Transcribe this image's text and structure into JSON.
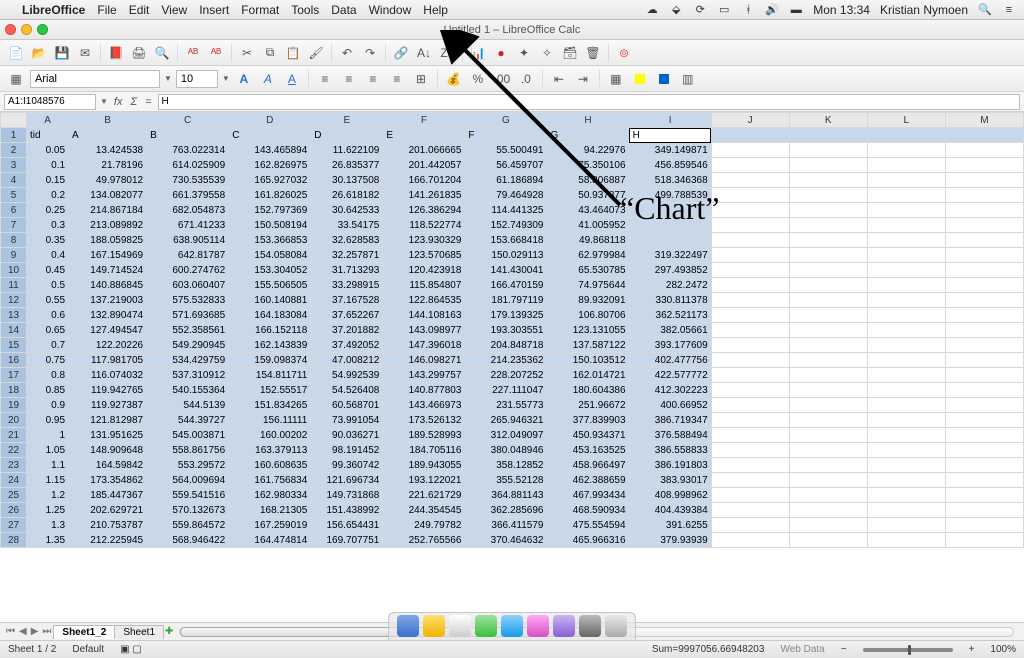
{
  "menubar": {
    "app": "LibreOffice",
    "items": [
      "File",
      "Edit",
      "View",
      "Insert",
      "Format",
      "Tools",
      "Data",
      "Window",
      "Help"
    ],
    "status": {
      "clock": "Mon 13:34",
      "user": "Kristian Nymoen"
    },
    "status_icons": [
      "cloud-icon",
      "dropbox-icon",
      "sync-icon",
      "bluetooth-icon",
      "wifi-icon",
      "volume-icon",
      "battery-icon",
      "input-icon",
      "spotlight-icon",
      "menu-icon"
    ]
  },
  "window": {
    "title": "Untitled 1 – LibreOffice Calc"
  },
  "formatbar": {
    "font": "Arial",
    "size": "10"
  },
  "refbar": {
    "cell": "A1:I1048576",
    "formula": "H"
  },
  "columns": [
    "A",
    "B",
    "C",
    "D",
    "E",
    "F",
    "G",
    "H",
    "I",
    "J",
    "K",
    "L",
    "M"
  ],
  "header_row": [
    "tid",
    "A",
    "B",
    "C",
    "D",
    "E",
    "F",
    "G",
    "H"
  ],
  "rows": [
    [
      "0.05",
      "13.424538",
      "763.022314",
      "143.465894",
      "11.622109",
      "201.066665",
      "55.500491",
      "94.22976",
      "349.149871"
    ],
    [
      "0.1",
      "21.78196",
      "614.025909",
      "162.826975",
      "26.835377",
      "201.442057",
      "56.459707",
      "75.350106",
      "456.859546"
    ],
    [
      "0.15",
      "49.978012",
      "730.535539",
      "165.927032",
      "30.137508",
      "166.701204",
      "61.186894",
      "58.806887",
      "518.346368"
    ],
    [
      "0.2",
      "134.082077",
      "661.379558",
      "161.826025",
      "26.618182",
      "141.261835",
      "79.464928",
      "50.937877",
      "499.788539"
    ],
    [
      "0.25",
      "214.867184",
      "682.054873",
      "152.797369",
      "30.642533",
      "126.386294",
      "114.441325",
      "43.464073",
      ""
    ],
    [
      "0.3",
      "213.089892",
      "671.41233",
      "150.508194",
      "33.54175",
      "118.522774",
      "152.749309",
      "41.005952",
      ""
    ],
    [
      "0.35",
      "188.059825",
      "638.905114",
      "153.366853",
      "32.628583",
      "123.930329",
      "153.668418",
      "49.868118",
      ""
    ],
    [
      "0.4",
      "167.154969",
      "642.81787",
      "154.058084",
      "32.257871",
      "123.570685",
      "150.029113",
      "62.979984",
      "319.322497"
    ],
    [
      "0.45",
      "149.714524",
      "600.274762",
      "153.304052",
      "31.713293",
      "120.423918",
      "141.430041",
      "65.530785",
      "297.493852"
    ],
    [
      "0.5",
      "140.886845",
      "603.060407",
      "155.506505",
      "33.298915",
      "115.854807",
      "166.470159",
      "74.975644",
      "282.2472"
    ],
    [
      "0.55",
      "137.219003",
      "575.532833",
      "160.140881",
      "37.167528",
      "122.864535",
      "181.797119",
      "89.932091",
      "330.811378"
    ],
    [
      "0.6",
      "132.890474",
      "571.693685",
      "164.183084",
      "37.652267",
      "144.108163",
      "179.139325",
      "106.80706",
      "362.521173"
    ],
    [
      "0.65",
      "127.494547",
      "552.358561",
      "166.152118",
      "37.201882",
      "143.098977",
      "193.303551",
      "123.131055",
      "382.05661"
    ],
    [
      "0.7",
      "122.20226",
      "549.290945",
      "162.143839",
      "37.492052",
      "147.396018",
      "204.848718",
      "137.587122",
      "393.177609"
    ],
    [
      "0.75",
      "117.981705",
      "534.429759",
      "159.098374",
      "47.008212",
      "146.098271",
      "214.235362",
      "150.103512",
      "402.477756"
    ],
    [
      "0.8",
      "116.074032",
      "537.310912",
      "154.811711",
      "54.992539",
      "143.299757",
      "228.207252",
      "162.014721",
      "422.577772"
    ],
    [
      "0.85",
      "119.942765",
      "540.155364",
      "152.55517",
      "54.526408",
      "140.877803",
      "227.111047",
      "180.604386",
      "412.302223"
    ],
    [
      "0.9",
      "119.927387",
      "544.5139",
      "151.834265",
      "60.568701",
      "143.466973",
      "231.55773",
      "251.96672",
      "400.66952"
    ],
    [
      "0.95",
      "121.812987",
      "544.39727",
      "156.11111",
      "73.991054",
      "173.526132",
      "265.946321",
      "377.839903",
      "386.719347"
    ],
    [
      "1",
      "131.951625",
      "545.003871",
      "160.00202",
      "90.036271",
      "189.528993",
      "312.049097",
      "450.934371",
      "376.588494"
    ],
    [
      "1.05",
      "148.909648",
      "558.861756",
      "163.379113",
      "98.191452",
      "184.705116",
      "380.048946",
      "453.163525",
      "386.558833"
    ],
    [
      "1.1",
      "164.59842",
      "553.29572",
      "160.608635",
      "99.360742",
      "189.943055",
      "358.12852",
      "458.966497",
      "386.191803"
    ],
    [
      "1.15",
      "173.354862",
      "564.009694",
      "161.756834",
      "121.696734",
      "193.122021",
      "355.52128",
      "462.388659",
      "383.93017"
    ],
    [
      "1.2",
      "185.447367",
      "559.541516",
      "162.980334",
      "149.731868",
      "221.621729",
      "364.881143",
      "467.993434",
      "408.998962"
    ],
    [
      "1.25",
      "202.629721",
      "570.132673",
      "168.21305",
      "151.438992",
      "244.354545",
      "362.285696",
      "468.590934",
      "404.439384"
    ],
    [
      "1.3",
      "210.753787",
      "559.864572",
      "167.259019",
      "156.654431",
      "249.79782",
      "366.411579",
      "475.554594",
      "391.6255"
    ],
    [
      "1.35",
      "212.225945",
      "568.946422",
      "164.474814",
      "169.707751",
      "252.765566",
      "370.464632",
      "465.966316",
      "379.93939"
    ]
  ],
  "sheets": {
    "tabs": [
      "Sheet1_2",
      "Sheet1"
    ],
    "active": 0
  },
  "statusbar": {
    "sheet": "Sheet 1 / 2",
    "style": "Default",
    "sum": "Sum=9997056.66948203",
    "webdata": "Web Data",
    "zoom": "100%"
  },
  "annotation": "“Chart”",
  "chart_button_name": "insert-chart-button"
}
